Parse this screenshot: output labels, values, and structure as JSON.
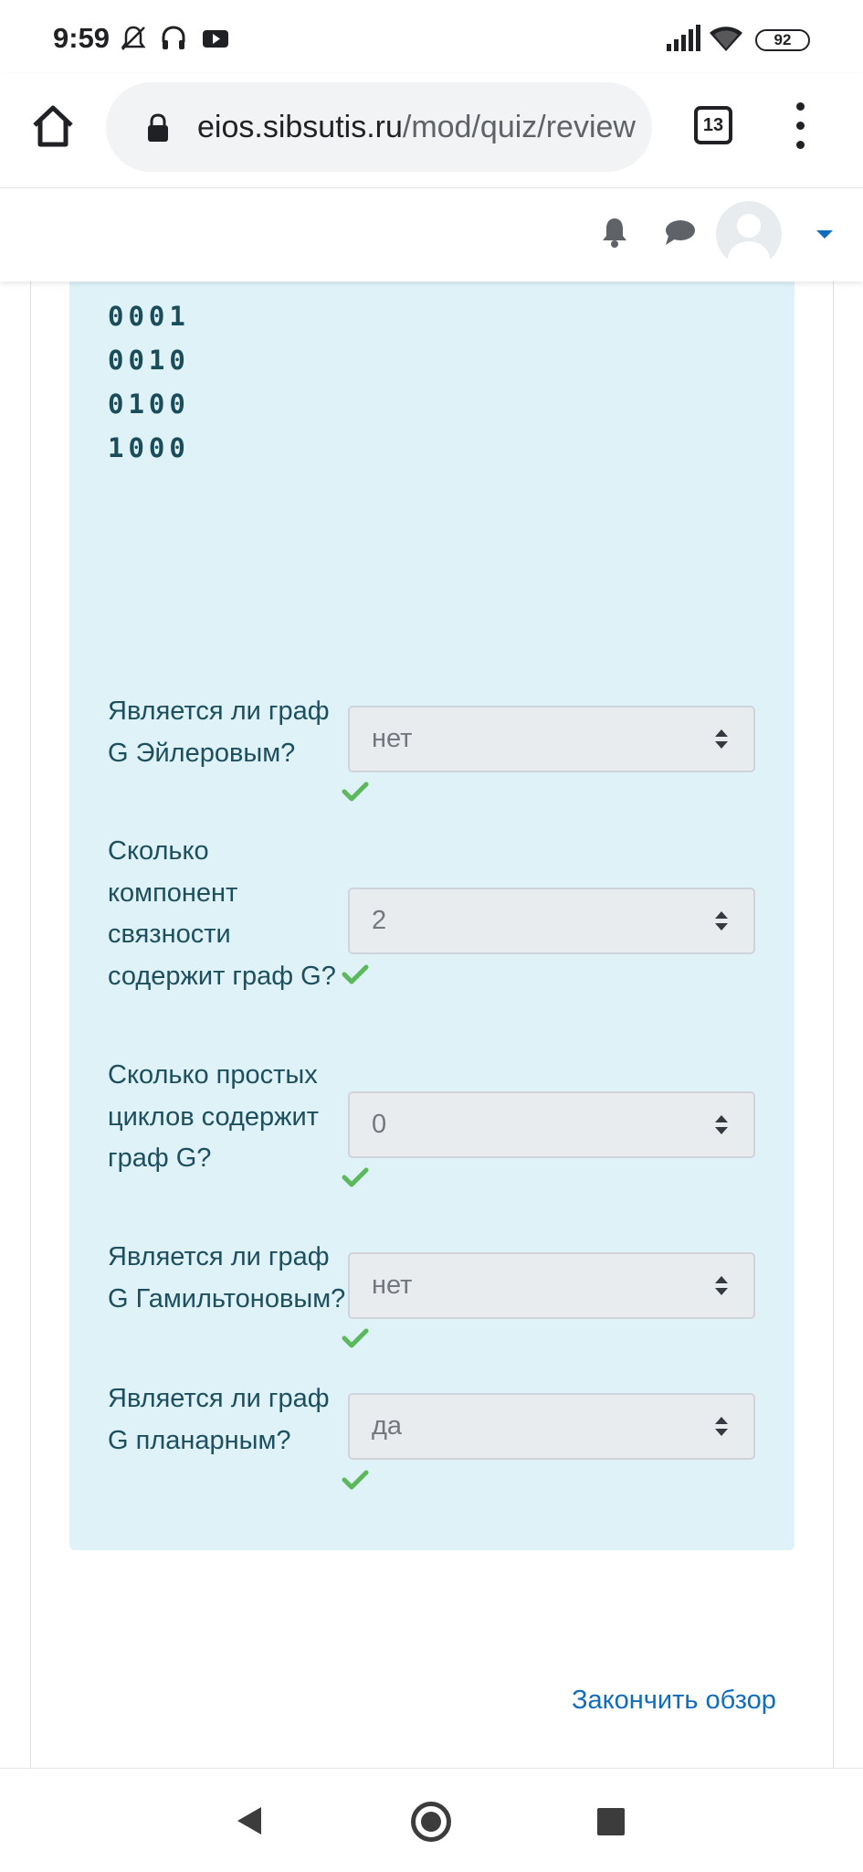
{
  "status_bar": {
    "time": "9:59",
    "battery": "92",
    "icons": [
      "mute-icon",
      "headset-icon",
      "youtube-icon",
      "signal-icon",
      "wifi-icon",
      "battery-icon"
    ]
  },
  "browser": {
    "url_domain": "eios.sibsutis.ru",
    "url_path": "/mod/quiz/review",
    "tab_count": "13"
  },
  "matrix_rows": [
    "0001",
    "0010",
    "0100",
    "1000"
  ],
  "questions": [
    {
      "label": "Является  ли граф G Эйлеровым?",
      "value": "нет",
      "correct": true
    },
    {
      "label": "Сколько компонент связности содержит граф G?",
      "value": "2",
      "correct": true
    },
    {
      "label": "Сколько простых циклов содержит граф G?",
      "value": "0",
      "correct": true
    },
    {
      "label": "Является  ли граф G Гамильтоновым?",
      "value": "нет",
      "correct": true
    },
    {
      "label": "Является  ли граф G планарным?",
      "value": "да",
      "correct": true
    }
  ],
  "finish_review_label": "Закончить обзор",
  "colors": {
    "question_bg": "#def2f8",
    "link": "#0f6cbf",
    "check": "#5cb85c",
    "label_text": "#1d4f5f"
  }
}
